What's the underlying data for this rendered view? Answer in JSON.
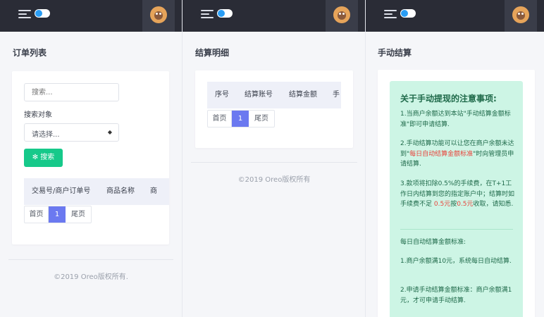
{
  "panels": [
    {
      "title": "订单列表",
      "search_placeholder": "搜索...",
      "search_target_label": "搜索对象",
      "select_value": "请选择...",
      "search_button": "搜索",
      "columns": [
        "交易号/商户订单号",
        "商品名称",
        "商"
      ],
      "pager": {
        "first": "首页",
        "current": "1",
        "last": "尾页"
      },
      "footer": "©2019 Oreo版权所有."
    },
    {
      "title": "结算明细",
      "columns": [
        "序号",
        "结算账号",
        "结算金额",
        "手"
      ],
      "pager": {
        "first": "首页",
        "current": "1",
        "last": "尾页"
      },
      "footer": "©2019 Oreo版权所有"
    },
    {
      "title": "手动结算",
      "notice": {
        "heading": "关于手动提现的注意事项:",
        "p1": "1.当商户余额达到本站\"手动结算金额标准\"即可申请结算.",
        "p2_a": "2.手动结算功能可以让您在商户余额未达到\"",
        "p2_red": "每日自动结算金额标准",
        "p2_b": "\"时向管理员申请结算.",
        "p3_a": "3.款项将扣除0.5%的手续费，在T+1工作日内结算到您的指定账户中；结算时如手续费不足 ",
        "p3_red1": "0.5元",
        "p3_b": "按",
        "p3_red2": "0.5元",
        "p3_c": "收取，请知悉.",
        "std_title": "每日自动结算金额标准:",
        "std1": "1.商户余额满10元，系统每日自动结算.",
        "std2": "2.申请手动结算金额标准：商户余额满1元，才可申请手动结算."
      }
    }
  ],
  "colors": {
    "topbar": "#2a2c36",
    "accent_green": "#16c98a",
    "pager_active": "#6b79f0",
    "notice_bg": "#cdf5e5",
    "notice_text": "#1f6a4a",
    "highlight_red": "#e8443b"
  },
  "icons": [
    "menu-icon",
    "theme-toggle-icon",
    "user-avatar",
    "search-icon",
    "select-arrow-icon"
  ]
}
